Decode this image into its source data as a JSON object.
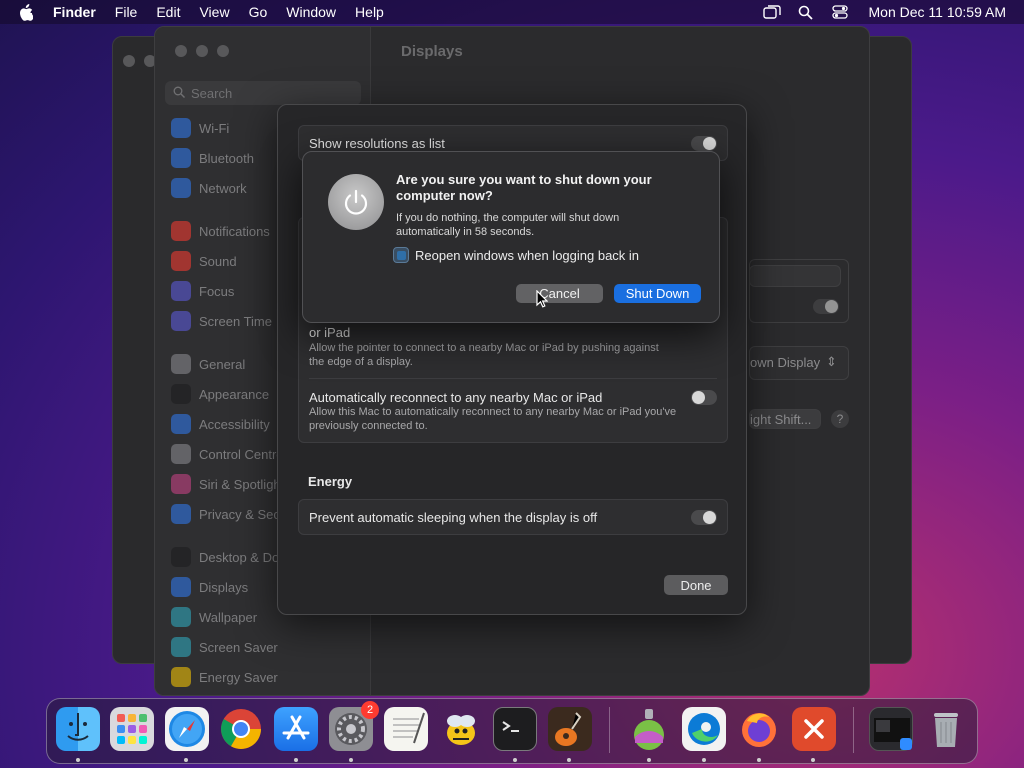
{
  "menubar": {
    "items": [
      "Finder",
      "File",
      "Edit",
      "View",
      "Go",
      "Window",
      "Help"
    ],
    "clock": "Mon Dec 11  10:59 AM",
    "status_icons": [
      "screen-mirroring-icon",
      "spotlight-search-icon",
      "control-center-icon"
    ]
  },
  "settings": {
    "title": "Displays",
    "search_placeholder": "Search",
    "sidebar": [
      {
        "label": "Wi-Fi",
        "color": "#2f7cf6"
      },
      {
        "label": "Bluetooth",
        "color": "#2f7cf6"
      },
      {
        "label": "Network",
        "color": "#2f7cf6"
      },
      {
        "label": "Notifications",
        "color": "#ff3b30"
      },
      {
        "label": "Sound",
        "color": "#ff3b30"
      },
      {
        "label": "Focus",
        "color": "#5e5ce6"
      },
      {
        "label": "Screen Time",
        "color": "#5e5ce6"
      },
      {
        "label": "General",
        "color": "#8e8e93"
      },
      {
        "label": "Appearance",
        "color": "#1c1c1e"
      },
      {
        "label": "Accessibility",
        "color": "#2f7cf6"
      },
      {
        "label": "Control Centre",
        "color": "#8e8e93"
      },
      {
        "label": "Siri & Spotlight",
        "color": "#d1438a"
      },
      {
        "label": "Privacy & Security",
        "color": "#2f7cf6"
      },
      {
        "label": "Desktop & Dock",
        "color": "#1c1c1e"
      },
      {
        "label": "Displays",
        "color": "#2f7cf6"
      },
      {
        "label": "Wallpaper",
        "color": "#30b0c7"
      },
      {
        "label": "Screen Saver",
        "color": "#30b0c7"
      },
      {
        "label": "Energy Saver",
        "color": "#ffcc00"
      }
    ],
    "background_buttons": {
      "display_dropdown": "own Display",
      "night_shift": "ight Shift...",
      "help": "?"
    }
  },
  "sheet": {
    "show_resolutions_label": "Show resolutions as list",
    "pointer_row_title_tail": "or iPad",
    "pointer_row_desc": "Allow the pointer to connect to a nearby Mac or iPad by pushing against the edge of a display.",
    "reconnect_title": "Automatically reconnect to any nearby Mac or iPad",
    "reconnect_desc": "Allow this Mac to automatically reconnect to any nearby Mac or iPad you've previously connected to.",
    "energy_heading": "Energy",
    "prevent_sleep_label": "Prevent automatic sleeping when the display is off",
    "done_label": "Done"
  },
  "alert": {
    "title": "Are you sure you want to shut down your computer now?",
    "message": "If you do nothing, the computer will shut down automatically in 58 seconds.",
    "checkbox_label": "Reopen windows when logging back in",
    "cancel_label": "Cancel",
    "shutdown_label": "Shut Down"
  },
  "dock": {
    "badge_count": "2",
    "apps": [
      "finder-icon",
      "launchpad-icon",
      "safari-icon",
      "chrome-icon",
      "app-store-icon",
      "system-settings-icon",
      "textedit-icon",
      "cyberduck-icon",
      "terminal-icon",
      "garageband-icon",
      "installer-icon",
      "edge-icon",
      "firefox-icon",
      "remote-desktop-icon",
      "recent-windows-icon",
      "trash-icon"
    ]
  }
}
